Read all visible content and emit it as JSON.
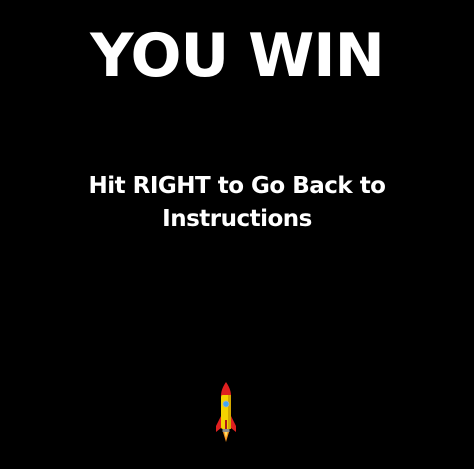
{
  "screen": {
    "title": "YOU WIN",
    "instruction": "Hit RIGHT to Go Back to Instructions",
    "player_icon": "rocket-icon"
  },
  "colors": {
    "background": "#000000",
    "text": "#ffffff",
    "rocket_body": "#f5d300",
    "rocket_fins": "#e02020",
    "rocket_window": "#3fa9f5",
    "rocket_flame": "#f7931e"
  }
}
